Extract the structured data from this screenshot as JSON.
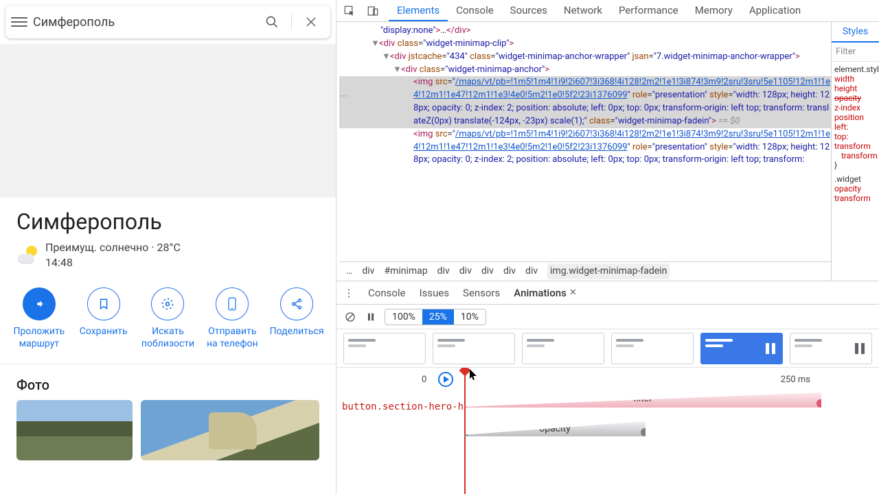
{
  "maps": {
    "search_value": "Симферополь",
    "place_title": "Симферополь",
    "weather_desc": "Преимущ. солнечно",
    "weather_temp": "28°C",
    "weather_time": "14:48",
    "actions": {
      "directions": "Проложить\nмаршрут",
      "save": "Сохранить",
      "nearby": "Искать\nпоблизости",
      "send": "Отправить\nна телефон",
      "share": "Поделиться"
    },
    "photo_section": "Фото"
  },
  "devtools": {
    "tabs": [
      "Elements",
      "Console",
      "Sources",
      "Network",
      "Performance",
      "Memory",
      "Application"
    ],
    "active_tab": "Elements",
    "styles": {
      "tab": "Styles",
      "filter_placeholder": "Filter",
      "selector1": "element.style {",
      "props1": [
        "width",
        "height",
        "opacity",
        "z-index",
        "position",
        "left:",
        "top:",
        "transform",
        "transform"
      ],
      "strike_idx": 2,
      "selector2": ".widget",
      "props2": [
        "opacity",
        "transform"
      ]
    },
    "elements": {
      "l0": "\"display:none\">…</div>",
      "l1_open": "<div class=\"widget-minimap-clip\">",
      "l2_open": "<div jstcache=\"434\" class=\"widget-minimap-anchor-wrapper\" jsan=\"7.widget-minimap-anchor-wrapper\">",
      "l3_open": "<div class=\"widget-minimap-anchor\">",
      "img_attr_role": "presentation",
      "img_src": "/maps/vt/pb=!1m5!1m4!1i9!2i607!3i368!4i128!2m2!1e1!3i874!3m9!2sru!3sru!5e1105!12m1!1e4!12m1!1e47!12m1!1e3!4e0!5m2!1e0!5f2!23i1376099",
      "img_style": "width: 128px; height: 128px; opacity: 0; z-index: 2; position: absolute; left: 0px; top: 0px; transform-origin: left top; transform: translateZ(0px) translate(-124px, -23px) scale(1);",
      "img_class": "widget-minimap-fadein",
      "eq0": " == $0"
    },
    "breadcrumbs": [
      "…",
      "div",
      "#minimap",
      "div",
      "div",
      "div",
      "div",
      "div",
      "img.widget-minimap-fadein"
    ],
    "drawer": {
      "tabs": [
        "Console",
        "Issues",
        "Sensors",
        "Animations"
      ],
      "active": "Animations",
      "speeds": [
        "100%",
        "25%",
        "10%"
      ],
      "speed_active": "25%",
      "tl_zero": "0",
      "tl_ms": "250 ms",
      "track_label": "button.section-hero-h",
      "track1": "filter",
      "track2": "opacity"
    }
  }
}
